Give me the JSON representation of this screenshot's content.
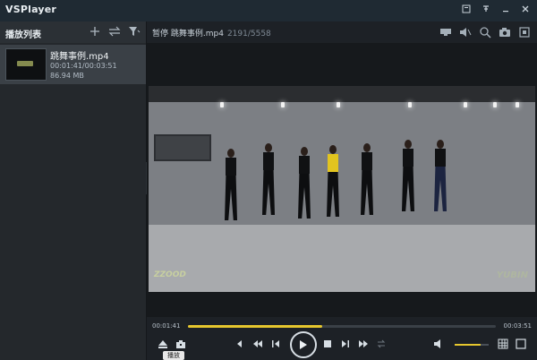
{
  "app": {
    "title": "VSPlayer"
  },
  "window": {
    "controls": [
      "menu-icon",
      "pin-icon",
      "minimize-icon",
      "close-icon"
    ]
  },
  "sidebar": {
    "title": "播放列表",
    "tools": [
      "add-icon",
      "swap-icon",
      "filter-icon"
    ],
    "items": [
      {
        "name": "跳舞事例.mp4",
        "time": "00:01:41/00:03:51",
        "size": "86.94 MB"
      }
    ]
  },
  "infobar": {
    "status": "暂停 跳舞事例.mp4",
    "frames": "2191/5558",
    "tools": [
      "hd-icon",
      "audio-icon",
      "zoom-icon",
      "snapshot-icon",
      "fullscreen-icon"
    ]
  },
  "video": {
    "watermark_left": "ZZOOD",
    "watermark_right": "YUBIN"
  },
  "controls": {
    "current_time": "00:01:41",
    "total_time": "00:03:51",
    "progress": 0.437,
    "volume": 0.75,
    "tooltip": "播放"
  },
  "colors": {
    "accent": "#e6c72e",
    "sidebar_bg": "#24282c",
    "titlebar_bg": "#1f2a33"
  }
}
